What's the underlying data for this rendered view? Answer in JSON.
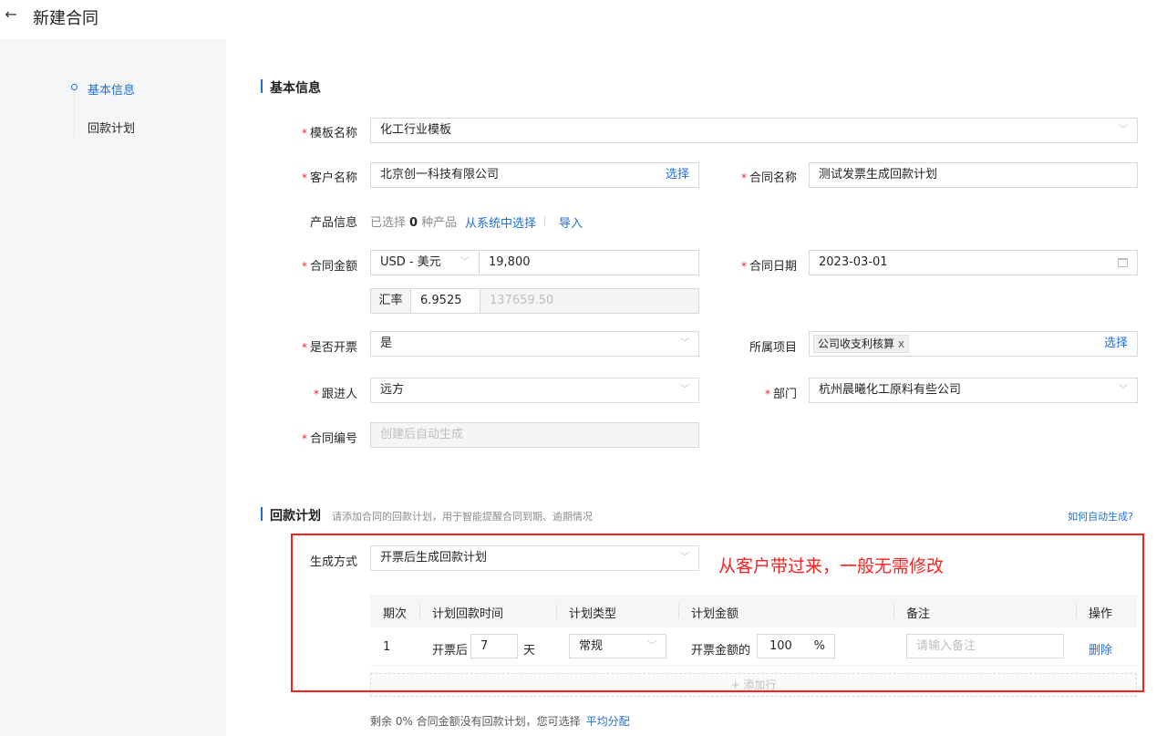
{
  "header": {
    "back_icon": "arrow-left-icon",
    "title": "新建合同"
  },
  "sidebar": {
    "items": [
      {
        "label": "基本信息",
        "active": true
      },
      {
        "label": "回款计划",
        "active": false
      }
    ]
  },
  "basic": {
    "title": "基本信息",
    "template": {
      "label": "模板名称",
      "value": "化工行业模板"
    },
    "customer": {
      "label": "客户名称",
      "value": "北京创一科技有限公司",
      "action": "选择"
    },
    "contract_name": {
      "label": "合同名称",
      "value": "测试发票生成回款计划"
    },
    "product": {
      "label": "产品信息",
      "prefix": "已选择",
      "count": "0",
      "suffix": "种产品",
      "from_system": "从系统中选择",
      "import": "导入"
    },
    "amount": {
      "label": "合同金额",
      "currency": "USD - 美元",
      "value": "19,800"
    },
    "rate": {
      "label": "汇率",
      "value": "6.9525",
      "converted": "137659.50"
    },
    "contract_date": {
      "label": "合同日期",
      "value": "2023-03-01"
    },
    "invoice": {
      "label": "是否开票",
      "value": "是"
    },
    "project": {
      "label": "所属项目",
      "tag": "公司收支利核算",
      "tag_close": "x",
      "action": "选择"
    },
    "follower": {
      "label": "跟进人",
      "value": "远方"
    },
    "department": {
      "label": "部门",
      "value": "杭州晨曦化工原料有些公司"
    },
    "contract_no": {
      "label": "合同编号",
      "placeholder": "创建后自动生成"
    }
  },
  "plan": {
    "title": "回款计划",
    "subtitle": "请添加合同的回款计划，用于智能提醒合同到期、逾期情况",
    "help": "如何自动生成?",
    "gen_mode": {
      "label": "生成方式",
      "value": "开票后生成回款计划"
    },
    "columns": [
      "期次",
      "计划回款时间",
      "计划类型",
      "计划金额",
      "备注",
      "操作"
    ],
    "rows": [
      {
        "period": "1",
        "after_label": "开票后",
        "days": "7",
        "days_unit": "天",
        "type": "常规",
        "amount_prefix": "开票金额的",
        "percent": "100",
        "percent_unit": "%",
        "remark_placeholder": "请输入备注",
        "action": "删除"
      }
    ],
    "add_row": "+ 添加行",
    "footer": "剩余 0% 合同金额没有回款计划，您可选择",
    "footer_link": "平均分配"
  },
  "annotation": {
    "text": "从客户带过来，一般无需修改",
    "color": "#ff2020"
  },
  "colors": {
    "accent": "#1e6fd9",
    "required": "#f5222d",
    "highlight": "#ff1f1f"
  }
}
